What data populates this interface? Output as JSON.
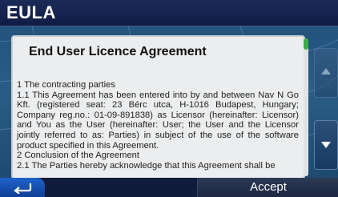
{
  "header": {
    "title": "EULA"
  },
  "document": {
    "heading": "End User Licence Agreement",
    "paragraphs": [
      "1 The contracting parties",
      "1.1 This Agreement has been entered into by and between Nav N Go Kft. (registered seat: 23 Bérc utca, H-1016 Budapest, Hungary; Company reg.no.: 01-09-891838) as Licensor (hereinafter: Licensor) and You as the User (hereinafter: User; the User and the Licensor jointly referred to as: Parties) in subject of the use of the software product specified in this Agreement.",
      "2 Conclusion of the Agreement",
      "2.1 The Parties hereby acknowledge that this Agreement shall be"
    ]
  },
  "scroll": {
    "up_icon": "arrow-up-icon",
    "down_icon": "arrow-down-icon",
    "position": 0.0
  },
  "footer": {
    "back_icon": "back-arrow-icon",
    "accept_label": "Accept"
  },
  "colors": {
    "accent_blue": "#1f63c9",
    "scroll_green": "#3cb043",
    "titlebar": "#0f1c45"
  }
}
